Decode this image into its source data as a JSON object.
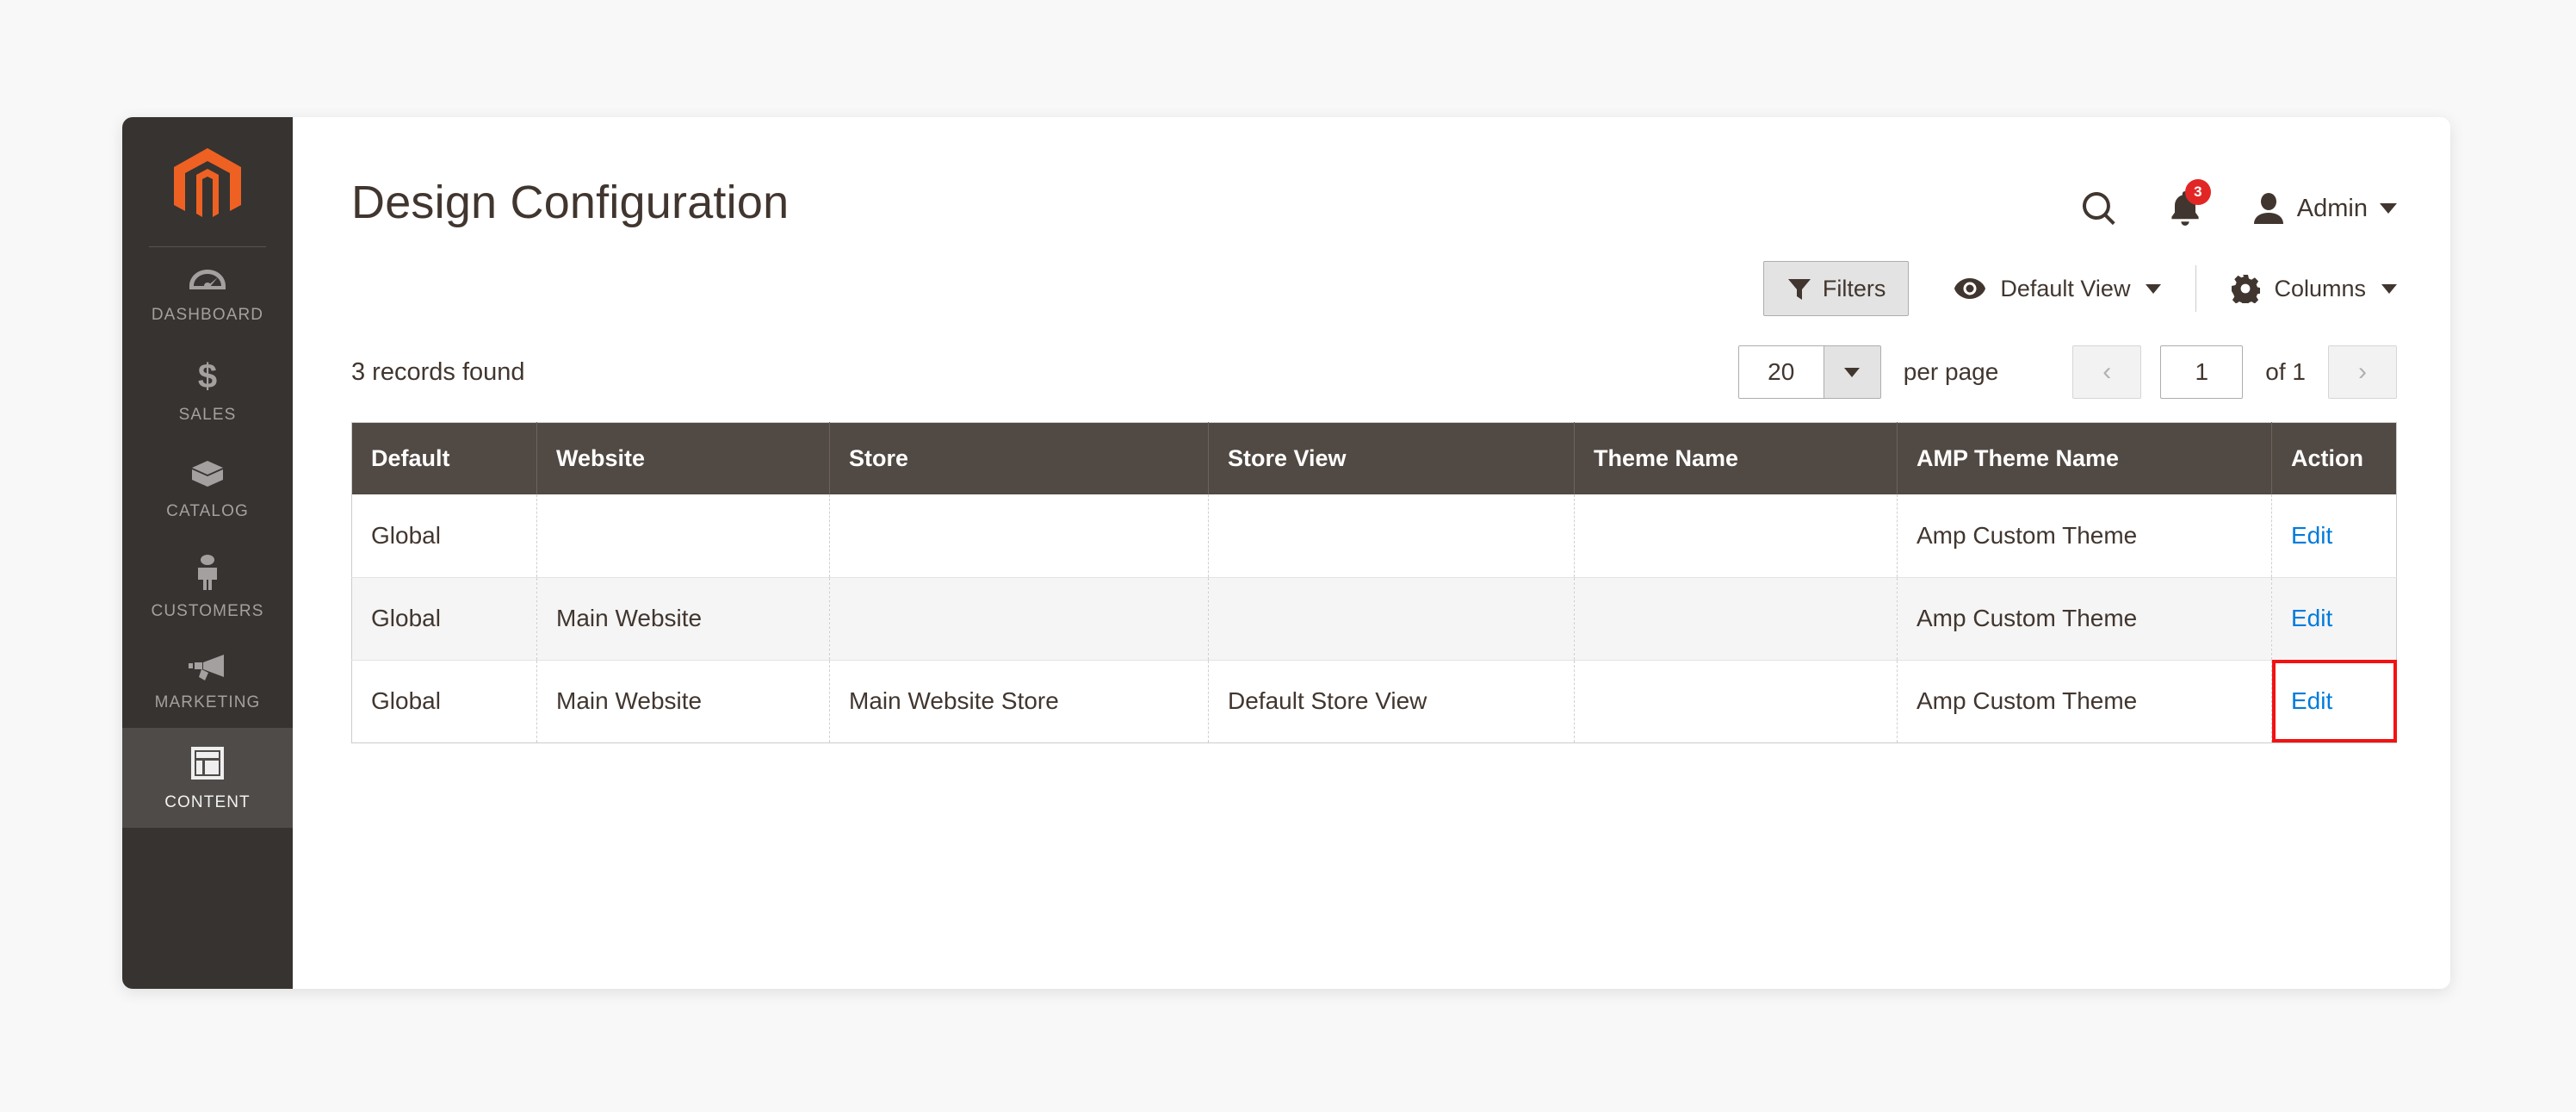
{
  "sidebar": {
    "logo": "magento-logo",
    "items": [
      {
        "label": "DASHBOARD",
        "icon": "dashboard-icon",
        "active": false
      },
      {
        "label": "SALES",
        "icon": "dollar-icon",
        "active": false
      },
      {
        "label": "CATALOG",
        "icon": "box-icon",
        "active": false
      },
      {
        "label": "CUSTOMERS",
        "icon": "person-icon",
        "active": false
      },
      {
        "label": "MARKETING",
        "icon": "megaphone-icon",
        "active": false
      },
      {
        "label": "CONTENT",
        "icon": "layout-icon",
        "active": true
      }
    ]
  },
  "header": {
    "title": "Design Configuration",
    "search_icon": "search-icon",
    "notifications_icon": "bell-icon",
    "notifications_count": "3",
    "avatar_icon": "user-avatar-icon",
    "admin_label": "Admin",
    "admin_caret": "chevron-down-icon"
  },
  "toolbar": {
    "filters_label": "Filters",
    "filters_icon": "funnel-icon",
    "view_label": "Default View",
    "view_icon": "eye-icon",
    "columns_label": "Columns",
    "columns_icon": "gear-icon"
  },
  "grid_controls": {
    "records_found": "3 records found",
    "per_page_value": "20",
    "per_page_label": "per page",
    "prev_label": "‹",
    "next_label": "›",
    "current_page": "1",
    "of_label": "of 1"
  },
  "table": {
    "columns": [
      "Default",
      "Website",
      "Store",
      "Store View",
      "Theme Name",
      "AMP Theme Name",
      "Action"
    ],
    "rows": [
      {
        "default": "Global",
        "website": "",
        "store": "",
        "store_view": "",
        "theme_name": "",
        "amp_theme_name": "Amp Custom Theme",
        "action": "Edit",
        "striped": false,
        "highlighted": false
      },
      {
        "default": "Global",
        "website": "Main Website",
        "store": "",
        "store_view": "",
        "theme_name": "",
        "amp_theme_name": "Amp Custom Theme",
        "action": "Edit",
        "striped": true,
        "highlighted": false
      },
      {
        "default": "Global",
        "website": "Main Website",
        "store": "Main Website Store",
        "store_view": "Default Store View",
        "theme_name": "",
        "amp_theme_name": "Amp Custom Theme",
        "action": "Edit",
        "striped": false,
        "highlighted": true
      }
    ]
  },
  "colors": {
    "page_background": "#f8f8f8",
    "sidebar_background": "#373330",
    "sidebar_active": "#4f4b48",
    "brand_orange": "#ee6123",
    "table_header": "#514943",
    "link_blue": "#007bdb",
    "badge_red": "#e22626",
    "highlight_red": "#f21212",
    "text_dark": "#41362f",
    "stripe": "#f5f5f5"
  }
}
